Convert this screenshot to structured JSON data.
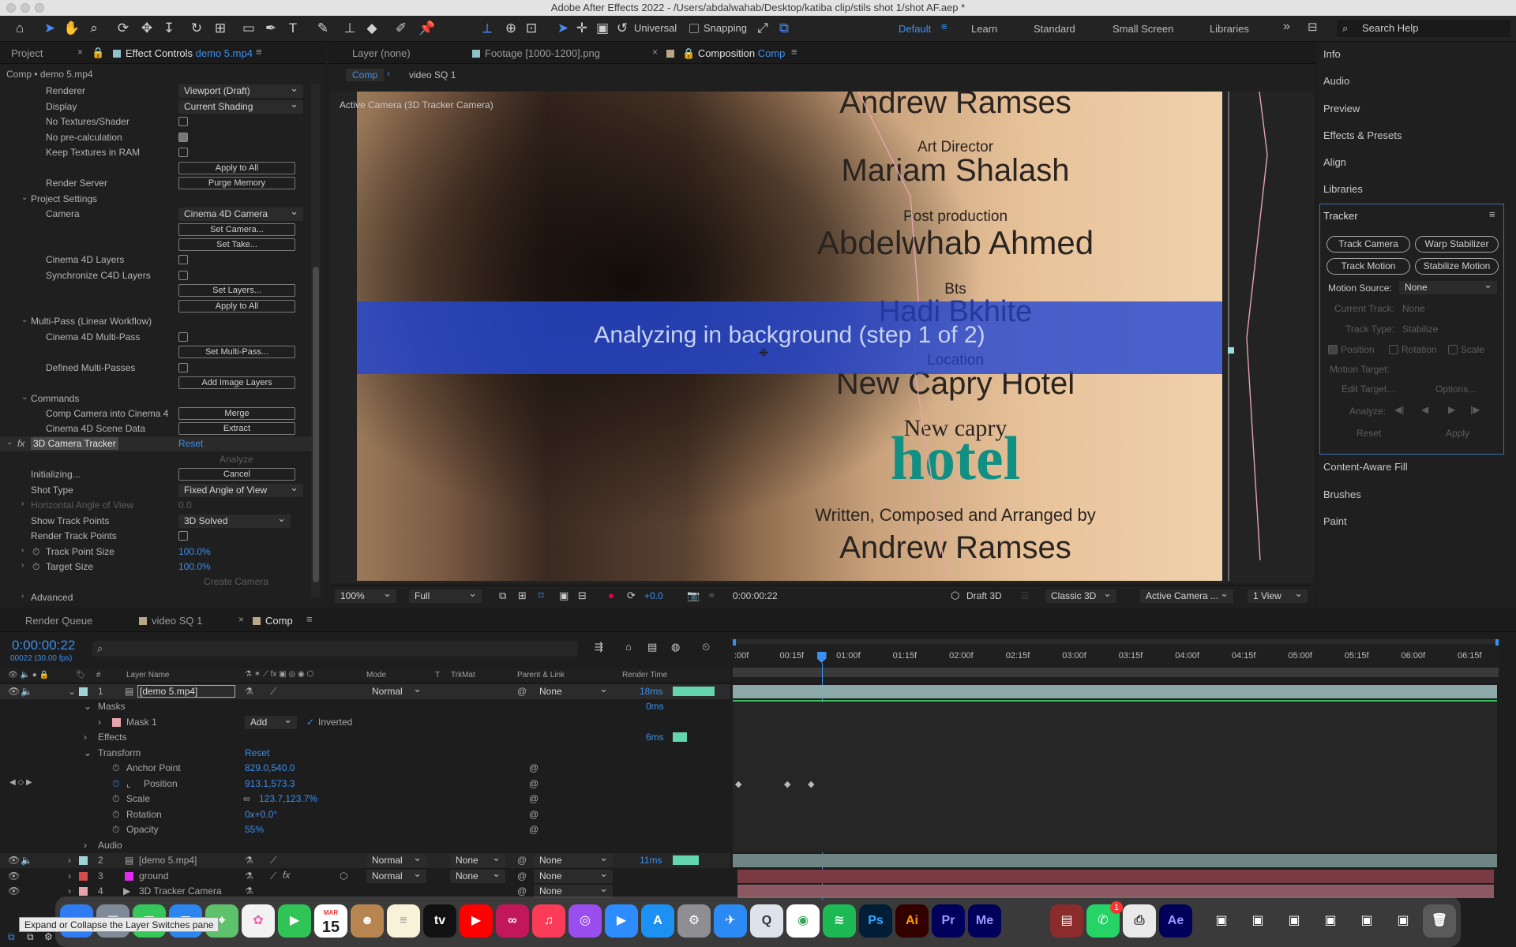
{
  "window": {
    "title": "Adobe After Effects 2022 - /Users/abdalwahab/Desktop/katiba clip/stils shot 1/shot AF.aep *"
  },
  "toolbar": {
    "universal": "Universal",
    "snapping": "Snapping",
    "workspaces": [
      "Default",
      "Learn",
      "Standard",
      "Small Screen",
      "Libraries"
    ],
    "search_placeholder": "Search Help"
  },
  "left_tabs": {
    "project": "Project",
    "effect_controls": "Effect Controls",
    "effect_controls_layer": "demo 5.mp4"
  },
  "ec": {
    "header": "Comp • demo 5.mp4",
    "renderer_label": "Renderer",
    "renderer_value": "Viewport (Draft)",
    "display_label": "Display",
    "display_value": "Current Shading",
    "no_textures": "No Textures/Shader",
    "no_precalc": "No pre-calculation",
    "keep_textures": "Keep Textures in RAM",
    "apply_all": "Apply to All",
    "render_server": "Render Server",
    "purge_memory": "Purge Memory",
    "project_settings": "Project Settings",
    "camera_label": "Camera",
    "camera_value": "Cinema 4D Camera",
    "set_camera": "Set Camera...",
    "set_take": "Set Take...",
    "c4d_layers": "Cinema 4D Layers",
    "sync_c4d_layers": "Synchronize C4D Layers",
    "set_layers": "Set Layers...",
    "apply_all2": "Apply to All",
    "multipass": "Multi-Pass (Linear Workflow)",
    "c4d_multipass": "Cinema 4D Multi-Pass",
    "set_multipass": "Set Multi-Pass...",
    "defined_multipasses": "Defined Multi-Passes",
    "add_image_layers": "Add Image Layers",
    "commands": "Commands",
    "comp_camera": "Comp Camera into Cinema 4",
    "merge": "Merge",
    "c4d_scene": "Cinema 4D Scene Data",
    "extract": "Extract",
    "tracker_name": "3D Camera Tracker",
    "reset": "Reset",
    "analyze": "Analyze",
    "initializing": "Initializing...",
    "cancel": "Cancel",
    "shot_type_label": "Shot Type",
    "shot_type_value": "Fixed Angle of View",
    "horiz_angle": "Horizontal Angle of View",
    "horiz_angle_value": "0.0",
    "show_track_points": "Show Track Points",
    "show_track_points_value": "3D Solved",
    "render_track_points": "Render Track Points",
    "track_point_size": "Track Point Size",
    "track_point_size_value": "100.0%",
    "target_size": "Target Size",
    "target_size_value": "100.0%",
    "create_camera": "Create Camera",
    "advanced": "Advanced"
  },
  "viewer": {
    "tabs": {
      "layer": "Layer (none)",
      "footage": "Footage [1000-1200].png",
      "composition": "Composition",
      "comp_name": "Comp"
    },
    "crumbs": {
      "comp": "Comp",
      "video": "video SQ 1"
    },
    "active_camera_label": "Active Camera (3D Tracker Camera)",
    "credits": {
      "name1": "Andrew Ramses",
      "role1": "Art Director",
      "name2": "Mariam Shalash",
      "role2": "Post production",
      "name3": "Abdelwhab Ahmed",
      "role3": "Bts",
      "name4": "Hadi Bkhite",
      "role4": "Location",
      "name5": "New Capry Hotel",
      "logo_top": "New capry",
      "logo_bottom": "hotel",
      "role5": "Written, Composed and Arranged by",
      "name6": "Andrew Ramses"
    },
    "analyzing": "Analyzing in background (step 1 of 2)",
    "bottom": {
      "zoom": "100%",
      "resolution": "Full",
      "exposure": "+0.0",
      "timecode": "0:00:00:22",
      "draft3d": "Draft 3D",
      "renderer": "Classic 3D",
      "camera": "Active Camera ...",
      "views": "1 View"
    }
  },
  "right_panel": {
    "items_top": [
      "Info",
      "Audio",
      "Preview",
      "Effects & Presets",
      "Align",
      "Libraries"
    ],
    "tracker_title": "Tracker",
    "track_camera": "Track Camera",
    "warp_stabilizer": "Warp Stabilizer",
    "track_motion": "Track Motion",
    "stabilize_motion": "Stabilize Motion",
    "motion_source_label": "Motion Source:",
    "motion_source_value": "None",
    "current_track_label": "Current Track:",
    "current_track_value": "None",
    "track_type_label": "Track Type:",
    "track_type_value": "Stabilize",
    "position": "Position",
    "rotation": "Rotation",
    "scale": "Scale",
    "motion_target": "Motion Target:",
    "edit_target": "Edit Target...",
    "options": "Options...",
    "analyze": "Analyze:",
    "reset": "Reset",
    "apply": "Apply",
    "items_bottom": [
      "Content-Aware Fill",
      "Brushes",
      "Paint"
    ]
  },
  "timeline": {
    "tabs": {
      "render_queue": "Render Queue",
      "video": "video SQ 1",
      "comp": "Comp"
    },
    "timecode": "0:00:00:22",
    "frames": "00022 (30.00 fps)",
    "headers": {
      "layer_name": "Layer Name",
      "mode": "Mode",
      "t": "T",
      "trkmat": "TrkMat",
      "parent": "Parent & Link",
      "render_time": "Render Time"
    },
    "layer1": {
      "num": "1",
      "name": "[demo 5.mp4]",
      "mode": "Normal",
      "parent": "None",
      "render": "18ms"
    },
    "masks": "Masks",
    "masks_time": "0ms",
    "mask1": "Mask 1",
    "mask1_mode": "Add",
    "inverted": "Inverted",
    "effects": "Effects",
    "effects_time": "6ms",
    "transform": "Transform",
    "transform_reset": "Reset",
    "anchor": "Anchor Point",
    "anchor_value": "829.0,540.0",
    "position": "Position",
    "position_value": "913.1,573.3",
    "scale": "Scale",
    "scale_value": "123.7,123.7%",
    "rotation": "Rotation",
    "rotation_value": "0x+0.0°",
    "opacity": "Opacity",
    "opacity_value": "55%",
    "audio": "Audio",
    "layer2": {
      "num": "2",
      "name": "[demo 5.mp4]",
      "mode": "Normal",
      "trkmat": "None",
      "parent": "None",
      "render": "11ms"
    },
    "layer3": {
      "num": "3",
      "name": "ground",
      "mode": "Normal",
      "trkmat": "None",
      "parent": "None"
    },
    "layer4": {
      "num": "4",
      "name": "3D Tracker Camera",
      "parent": "None"
    },
    "ruler": [
      ":00f",
      "00:15f",
      "01:00f",
      "01:15f",
      "02:00f",
      "02:15f",
      "03:00f",
      "03:15f",
      "04:00f",
      "04:15f",
      "05:00f",
      "05:15f",
      "06:00f",
      "06:15f"
    ],
    "playhead_fraction": 0.116
  },
  "tooltip": "Expand or Collapse the Layer Switches pane",
  "dock": {
    "calendar_month": "MAR",
    "calendar_day": "15",
    "badge": "1"
  }
}
